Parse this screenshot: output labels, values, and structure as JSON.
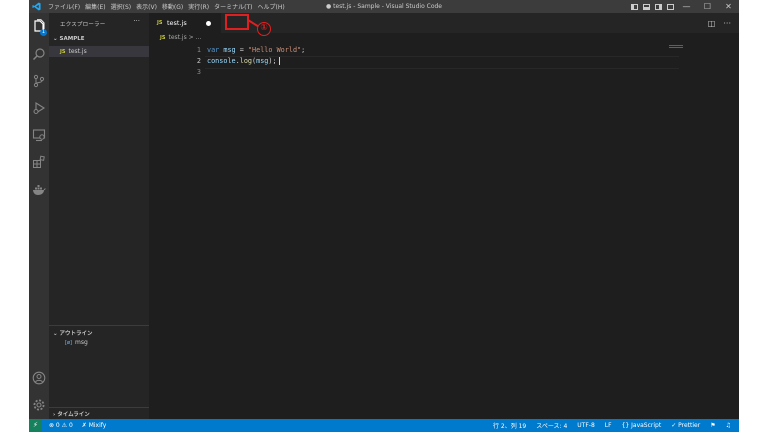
{
  "titlebar": {
    "menu": [
      "ファイル(F)",
      "編集(E)",
      "選択(S)",
      "表示(V)",
      "移動(G)",
      "実行(R)",
      "ターミナル(T)",
      "ヘルプ(H)"
    ],
    "title": "● test.js - Sample - Visual Studio Code",
    "minimize": "—",
    "maximize": "☐",
    "close": "✕"
  },
  "activity": {
    "explorer_badge": "1"
  },
  "sidebar": {
    "header": "エクスプローラー",
    "more": "···",
    "folder": "SAMPLE",
    "file": {
      "icon": "JS",
      "name": "test.js"
    },
    "outline": {
      "header": "アウトライン",
      "symbol_icon": "[ø]",
      "symbol": "msg"
    },
    "timeline": "タイムライン"
  },
  "editor": {
    "tab": {
      "icon": "JS",
      "name": "test.js"
    },
    "breadcrumb": {
      "folder": "JS",
      "file": "test.js",
      "sep": ">",
      "tail": "..."
    },
    "lines": [
      {
        "num": "1",
        "tokens": [
          {
            "text": "var",
            "cls": "kw"
          },
          {
            "text": " ",
            "cls": ""
          },
          {
            "text": "msg",
            "cls": "var"
          },
          {
            "text": " = ",
            "cls": ""
          },
          {
            "text": "\"Hello World\"",
            "cls": "str"
          },
          {
            "text": ";",
            "cls": ""
          }
        ]
      },
      {
        "num": "2",
        "current": true,
        "tokens": [
          {
            "text": "console",
            "cls": "var"
          },
          {
            "text": ".",
            "cls": ""
          },
          {
            "text": "log",
            "cls": "fn"
          },
          {
            "text": "(",
            "cls": ""
          },
          {
            "text": "msg",
            "cls": "var"
          },
          {
            "text": ");",
            "cls": ""
          }
        ]
      },
      {
        "num": "3",
        "tokens": []
      }
    ]
  },
  "annotation": {
    "number": "①",
    "color": "#e02020"
  },
  "statusbar": {
    "remote": "⚡",
    "problems": "⊗ 0 ⚠ 0",
    "mixify": "✗ Mixify",
    "position": "行 2、列 19",
    "spaces": "スペース: 4",
    "encoding": "UTF-8",
    "eol": "LF",
    "language": "{} JavaScript",
    "prettier": "✓ Prettier"
  },
  "colors": {
    "accent": "#007acc",
    "editor_bg": "#1e1e1e",
    "sidebar_bg": "#252526",
    "activity_bg": "#333333"
  }
}
